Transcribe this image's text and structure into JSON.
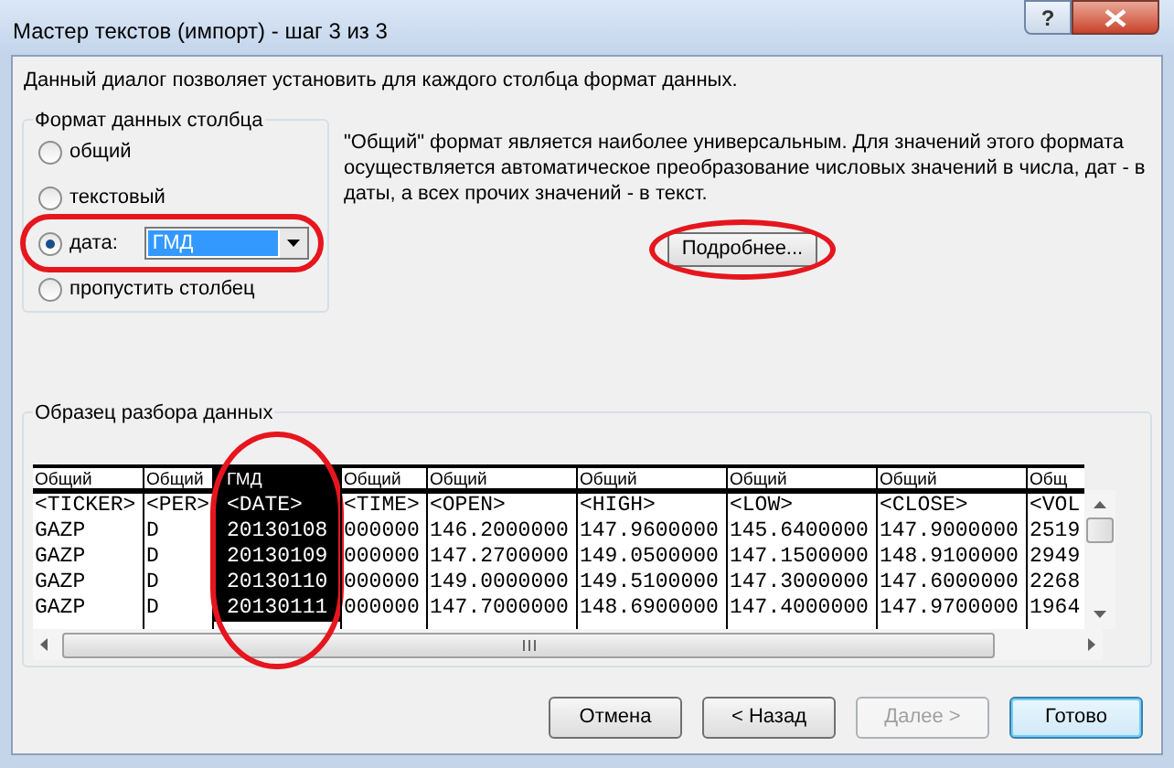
{
  "window": {
    "title": "Мастер текстов (импорт) - шаг 3 из 3",
    "help_button": "?"
  },
  "intro": "Данный диалог позволяет установить для каждого столбца формат данных.",
  "column_format": {
    "title": "Формат данных столбца",
    "options": [
      {
        "label": "общий",
        "selected": false
      },
      {
        "label": "текстовый",
        "selected": false
      },
      {
        "label": "дата:",
        "selected": true,
        "dropdown": "ГМД"
      },
      {
        "label": "пропустить столбец",
        "selected": false
      }
    ]
  },
  "description": "\"Общий\" формат является наиболее универсальным. Для значений этого формата осуществляется автоматическое преобразование числовых значений в числа, дат - в даты, а всех прочих значений - в текст.",
  "more_button": "Подробнее...",
  "preview": {
    "title": "Образец разбора данных",
    "columns": [
      {
        "format": "Общий",
        "selected": false,
        "cells": [
          "<TICKER>",
          "GAZP",
          "GAZP",
          "GAZP",
          "GAZP"
        ]
      },
      {
        "format": "Общий",
        "selected": false,
        "cells": [
          "<PER>",
          "D",
          "D",
          "D",
          "D"
        ]
      },
      {
        "format": "ГМД",
        "selected": true,
        "cells": [
          "<DATE>",
          "20130108",
          "20130109",
          "20130110",
          "20130111"
        ]
      },
      {
        "format": "Общий",
        "selected": false,
        "cells": [
          "<TIME>",
          "000000",
          "000000",
          "000000",
          "000000"
        ]
      },
      {
        "format": "Общий",
        "selected": false,
        "cells": [
          "<OPEN>",
          "146.2000000",
          "147.2700000",
          "149.0000000",
          "147.7000000"
        ]
      },
      {
        "format": "Общий",
        "selected": false,
        "cells": [
          "<HIGH>",
          "147.9600000",
          "149.0500000",
          "149.5100000",
          "148.6900000"
        ]
      },
      {
        "format": "Общий",
        "selected": false,
        "cells": [
          "<LOW>",
          "145.6400000",
          "147.1500000",
          "147.3000000",
          "147.4000000"
        ]
      },
      {
        "format": "Общий",
        "selected": false,
        "cells": [
          "<CLOSE>",
          "147.9000000",
          "148.9100000",
          "147.6000000",
          "147.9700000"
        ]
      },
      {
        "format": "Общ",
        "selected": false,
        "cells": [
          "<VOL",
          "2519",
          "2949",
          "2268",
          "1964"
        ]
      }
    ]
  },
  "buttons": [
    {
      "label": "Отмена",
      "disabled": false,
      "default": false
    },
    {
      "label": "< Назад",
      "disabled": false,
      "default": false
    },
    {
      "label": "Далее >",
      "disabled": true,
      "default": false
    },
    {
      "label": "Готово",
      "disabled": false,
      "default": true
    }
  ]
}
